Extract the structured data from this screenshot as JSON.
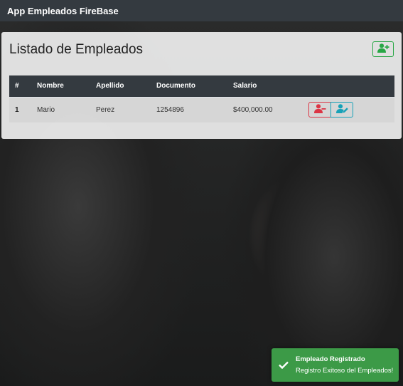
{
  "navbar": {
    "brand": "App Empleados FireBase"
  },
  "main": {
    "title": "Listado de Empleados",
    "add_icon": "user-plus-icon",
    "table": {
      "headers": [
        "#",
        "Nombre",
        "Apellido",
        "Documento",
        "Salario"
      ],
      "rows": [
        {
          "idx": "1",
          "nombre": "Mario",
          "apellido": "Perez",
          "documento": "1254896",
          "salario": "$400,000.00"
        }
      ]
    },
    "row_actions": {
      "delete_icon": "user-minus-icon",
      "edit_icon": "user-edit-icon"
    }
  },
  "toast": {
    "title": "Empleado Registrado",
    "message": "Registro Exitoso del Empleados!",
    "icon": "check-icon"
  },
  "colors": {
    "success": "#28a745",
    "danger": "#dc3545",
    "info": "#17a2b8",
    "dark": "#343a40",
    "toast": "#3c9a47"
  }
}
